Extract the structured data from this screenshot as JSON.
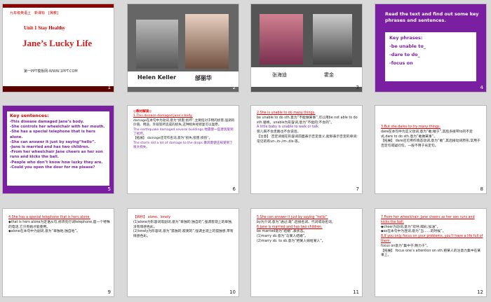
{
  "slides": [
    {
      "num": "1",
      "header": "九年级英语上　新课标　[冀教]",
      "unit": "Unit 1  Stay Healthy",
      "title": "Jane’s Lucky Life",
      "website": "第一PPT模板网-WWW.1PPT.COM"
    },
    {
      "num": "2",
      "captions": [
        "Helen Keller",
        "邰丽华"
      ]
    },
    {
      "num": "3",
      "captions": [
        "张海迪",
        "霍金"
      ]
    },
    {
      "num": "4",
      "prompt": "Read the text and find out some key phrases and sentences.",
      "heading": "Key phrases:",
      "items": [
        "-be unable to_",
        "-dare to do_",
        "-focus on"
      ]
    },
    {
      "num": "5",
      "heading": "Key sentences:",
      "items": [
        "-This disease damaged Jane’s body.",
        "-She controls her wheelchair with her mouth.",
        "-She has a special telephone that is hers alone.",
        "-She can answer it just by saying“hello”.",
        "-Jane is married and has two children.",
        "-From her wheelchair Jane cheers as her son runs and kicks the ball.",
        "-People who don’t know how lucky they are.",
        "-Could you open the door for me please?"
      ]
    },
    {
      "num": "6",
      "heading": "◎教材解读◎",
      "lines": [
        "1.This disease damaged Jane’s body.",
        "damage在本句中为动词,意为“损害;损坏”,主要指对于物的损害,强调的价值、用途、外观等所造成的损失,这种损失经修复可以复原。",
        "The earthquake damaged several buildings.地震使一些建筑受到了损坏。",
        "【拓展】 damage还可作名词,意为“损失;损害;损伤”。",
        "The storm did a lot of damage to the drops.暴风雨使庄稼受到了很大损失。"
      ]
    },
    {
      "num": "7",
      "lines": [
        "2.She is unable to do many things.",
        "be unable to do sth.意为“不能做某事”,可以用be not able to do sth.替换。unable为形容词,意为“不能的;不会的”。",
        "A little baby is unable to walk or talk.",
        "婴儿既不会走路也不会说话。",
        "【注意】 否定词缀在形容词前面表示否定意义,能够表示否定的单词:常见的有un-,in-,im-,dis-等。"
      ]
    },
    {
      "num": "8",
      "lines": [
        "3.But she dares to try many things.",
        "dare在本句中为实义动词,意为“敢;敢于”,其后多接带to的不定式,dare to do sth.意为“敢做某事”。",
        "【拓展】 dare还可用作情态动词,意为“敢”,其后接动词原形,常用于否定句或疑问句。一般不用于肯定句。"
      ]
    },
    {
      "num": "9",
      "lines": [
        "4.She has a special telephone that is hers alone.",
        "◆that is hers alone为定语从句,修饰先行词telephone,是一个特殊的电话,它只有她才能使用。",
        "◆alone在本句中为副词,意为“单独地;独自地”。"
      ]
    },
    {
      "num": "10",
      "lines": [
        "【辨析】 alone、lonely",
        "(1)alone为形容词或副词,意为“单独的;独自的”,强调客观上的单独,没有情感色彩。",
        "(2)lonely为形容词,意为“孤独的;寂寞的”,强调主观上的孤独感,带有情感色彩。"
      ]
    },
    {
      "num": "11",
      "lines": [
        "5.She can answer it just by saying “hello”.",
        "by为介词,意为“通过;靠”,后接名词、代词或动名词。",
        "6.Jane is married and has two children.",
        "be married意为“结婚”,表状态。",
        "(1)marry sb.意为“与某人结婚”。",
        "(2)marry sb. to sb.意为“把某人嫁给某人”。"
      ]
    },
    {
      "num": "12",
      "lines": [
        "7.From her wheelchair, Jane cheers as her son runs and kicks the ball.",
        "◆cheer为动词,意为“欢呼,喝彩;加油”。",
        "◆as在本句中为连词,意为“当……的时候”。",
        "8.If you only focus on your problems, you’ll have a life full of them.",
        "focus on意为“集中于;致力于”。",
        "【拓展】 focus one’s attention on sth.把某人的注意力集中在某事上。"
      ]
    }
  ]
}
